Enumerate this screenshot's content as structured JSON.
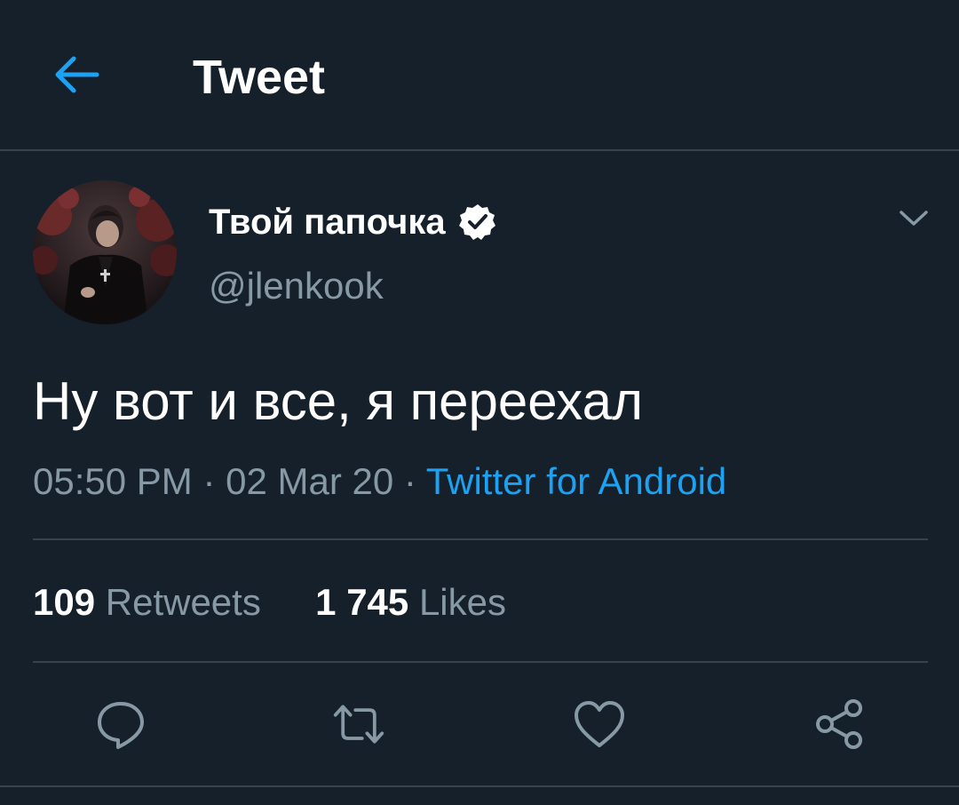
{
  "header": {
    "title": "Tweet",
    "back_icon": "arrow-left-icon"
  },
  "author": {
    "display_name": "Твой папочка",
    "handle": "@jlenkook",
    "verified": true,
    "avatar": "profile-photo"
  },
  "tweet": {
    "text": "Ну вот и все, я переехал",
    "time": "05:50 PM",
    "date": "02 Mar 20",
    "separator": "·",
    "source": "Twitter for Android"
  },
  "stats": {
    "retweets_count": "109",
    "retweets_label": "Retweets",
    "likes_count": "1 745",
    "likes_label": "Likes"
  },
  "actions": [
    {
      "name": "reply",
      "icon": "reply-icon"
    },
    {
      "name": "retweet",
      "icon": "retweet-icon"
    },
    {
      "name": "like",
      "icon": "heart-icon"
    },
    {
      "name": "share",
      "icon": "share-icon"
    }
  ],
  "colors": {
    "background": "#15202b",
    "accent": "#1da1f2",
    "secondary_text": "#8899a6",
    "divider": "#38444d"
  }
}
